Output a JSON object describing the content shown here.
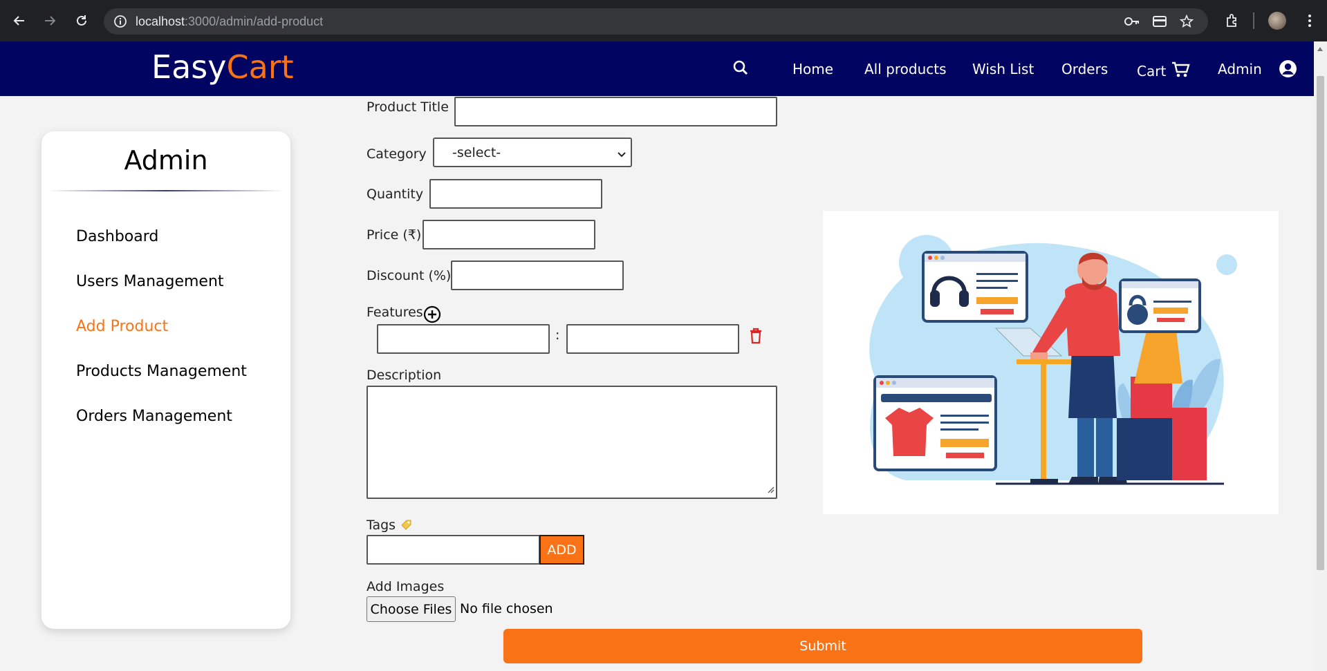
{
  "browser": {
    "url_host": "localhost",
    "url_path": ":3000/admin/add-product"
  },
  "navbar": {
    "brand_first": "Easy",
    "brand_second": "Cart",
    "links": [
      "Home",
      "All products",
      "Wish List",
      "Orders",
      "Cart",
      "Admin"
    ]
  },
  "sidebar": {
    "title": "Admin",
    "items": [
      {
        "label": "Dashboard",
        "active": false
      },
      {
        "label": "Users Management",
        "active": false
      },
      {
        "label": "Add Product",
        "active": true
      },
      {
        "label": "Products Management",
        "active": false
      },
      {
        "label": "Orders Management",
        "active": false
      }
    ]
  },
  "form": {
    "product_title_label": "Product Title",
    "category_label": "Category",
    "category_selected": "-select-",
    "quantity_label": "Quantity",
    "price_label": "Price (₹)",
    "discount_label": "Discount (%)",
    "features_label": "Features",
    "feature_separator": ":",
    "description_label": "Description",
    "tags_label": "Tags",
    "tags_add_label": "ADD",
    "images_label": "Add Images",
    "choose_files_label": "Choose Files",
    "file_status": "No file chosen",
    "submit_label": "Submit"
  },
  "colors": {
    "navbar_bg": "#010460",
    "accent": "#f97316",
    "page_bg": "#f3f3f3"
  }
}
